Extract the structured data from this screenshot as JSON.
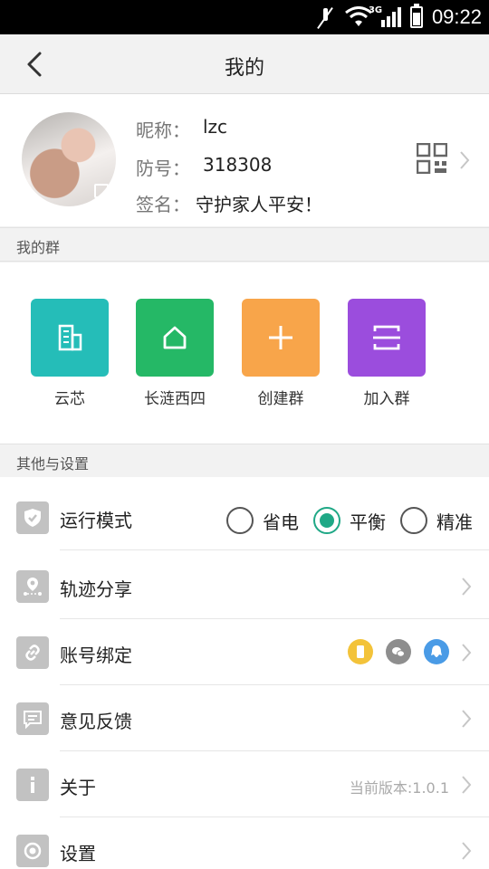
{
  "status_bar": {
    "network": "3G",
    "time": "09:22"
  },
  "header": {
    "title": "我的"
  },
  "profile": {
    "nickname_label": "昵称：",
    "nickname": "lzc",
    "id_label": "防号：",
    "id": "318308",
    "signature_label": "签名：",
    "signature": "守护家人平安！"
  },
  "groups_section": {
    "title": "我的群",
    "items": [
      {
        "label": "云芯",
        "color": "#25bdb8",
        "icon": "building-icon"
      },
      {
        "label": "长涟西四",
        "color": "#25b866",
        "icon": "house-icon"
      },
      {
        "label": "创建群",
        "color": "#f8a54a",
        "icon": "plus-icon"
      },
      {
        "label": "加入群",
        "color": "#9b4ddd",
        "icon": "scan-icon"
      }
    ]
  },
  "settings_section": {
    "title": "其他与设置",
    "run_mode": {
      "label": "运行模式",
      "options": [
        "省电",
        "平衡",
        "精准"
      ],
      "selected": "平衡"
    },
    "rows": [
      {
        "label": "轨迹分享",
        "icon": "location-share-icon"
      },
      {
        "label": "账号绑定",
        "icon": "link-icon",
        "bind_icons": [
          "phone-icon",
          "wechat-icon",
          "qq-icon"
        ]
      },
      {
        "label": "意见反馈",
        "icon": "feedback-icon"
      },
      {
        "label": "关于",
        "icon": "info-icon",
        "value": "当前版本:1.0.1"
      },
      {
        "label": "设置",
        "icon": "settings-icon"
      }
    ]
  },
  "colors": {
    "accent": "#1fa886",
    "icon_gray": "#c2c2c2",
    "background": "#f2f2f2"
  }
}
